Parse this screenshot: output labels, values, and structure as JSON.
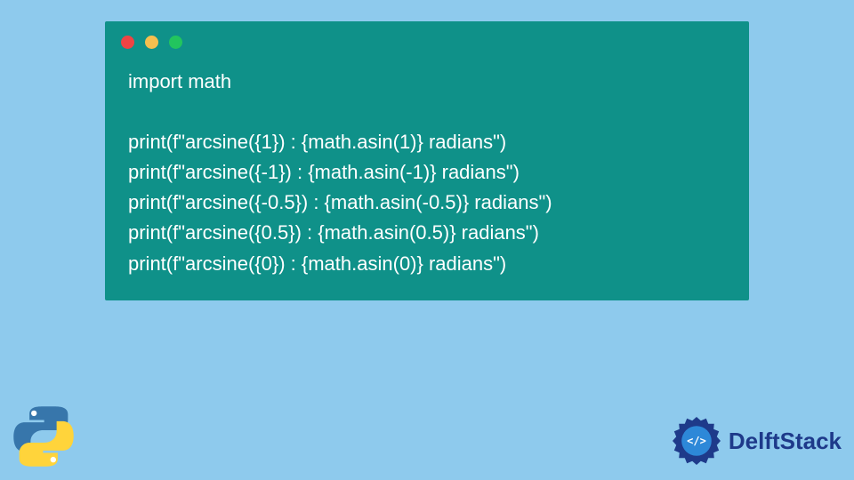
{
  "code": {
    "lines": [
      "import math",
      "",
      "print(f\"arcsine({1}) : {math.asin(1)} radians\")",
      "print(f\"arcsine({-1}) : {math.asin(-1)} radians\")",
      "print(f\"arcsine({-0.5}) : {math.asin(-0.5)} radians\")",
      "print(f\"arcsine({0.5}) : {math.asin(0.5)} radians\")",
      "print(f\"arcsine({0}) : {math.asin(0)} radians\")"
    ]
  },
  "branding": {
    "name": "DelftStack"
  },
  "window": {
    "controls": [
      "close",
      "minimize",
      "maximize"
    ]
  }
}
